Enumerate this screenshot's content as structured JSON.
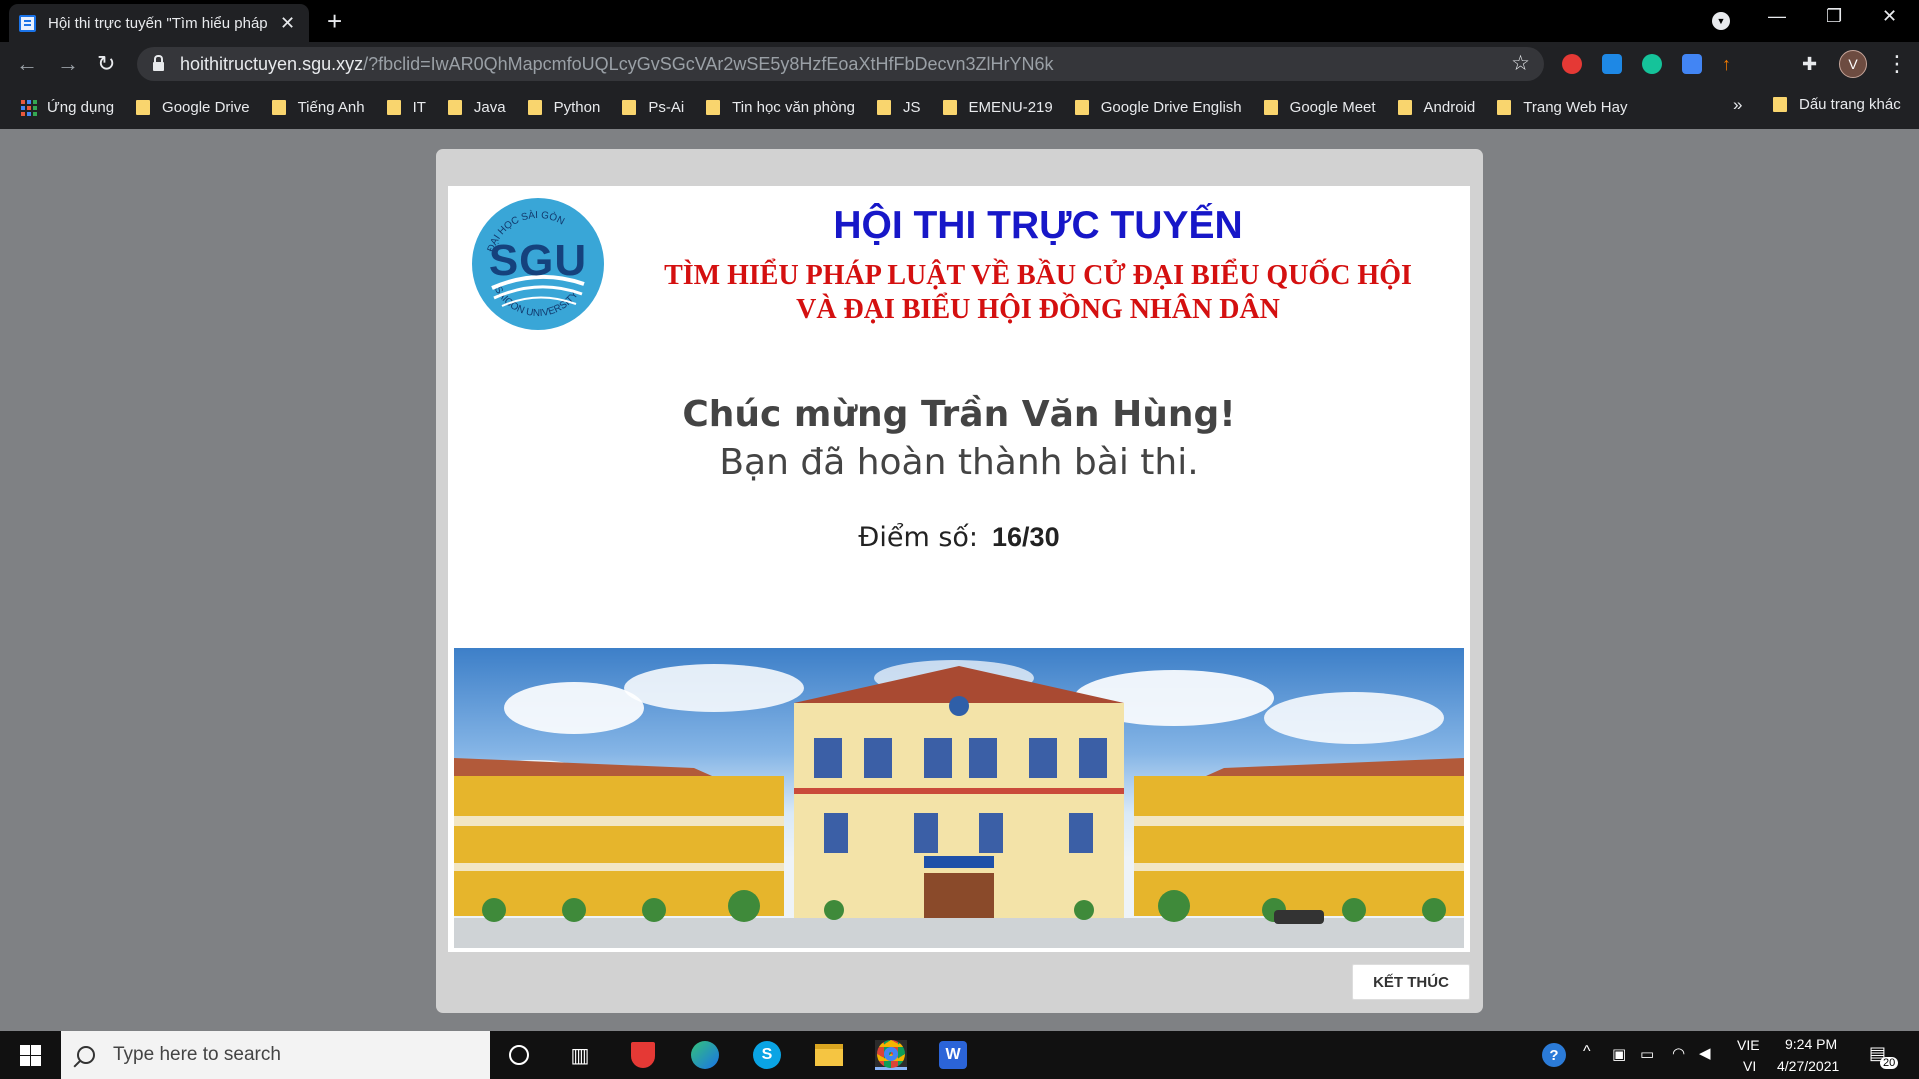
{
  "browser": {
    "tab_title": "Hội thi trực tuyến \"Tìm hiểu pháp",
    "tab_close": "✕",
    "new_tab": "+",
    "url_host": "hoithitructuyen.sgu.xyz",
    "url_path": "/?fbclid=IwAR0QhMapcmfoUQLcyGvSGcVAr2wSE5y8HzfEoaXtHfFbDecvn3ZlHrYN6k",
    "profile_initial": "V",
    "window_min": "—",
    "window_restore": "❐",
    "window_close": "✕"
  },
  "bookmarks": {
    "apps_label": "Ứng dụng",
    "items": [
      "Google Drive",
      "Tiếng Anh",
      "IT",
      "Java",
      "Python",
      "Ps-Ai",
      "Tin học văn phòng",
      "JS",
      "EMENU-219",
      "Google Drive English",
      "Google Meet",
      "Android",
      "Trang Web Hay"
    ],
    "more": "»",
    "other": "Dấu trang khác"
  },
  "page": {
    "logo_text": "SGU",
    "logo_top": "ĐẠI HỌC SÀI GÒN",
    "logo_bottom": "SAIGON UNIVERSITY",
    "title": "HỘI THI TRỰC TUYẾN",
    "subtitle_1": "TÌM HIỂU PHÁP LUẬT VỀ BẦU CỬ ĐẠI BIỂU QUỐC HỘI",
    "subtitle_2": "VÀ ĐẠI BIỂU HỘI ĐỒNG NHÂN DÂN",
    "congrats": "Chúc mừng Trần Văn Hùng!",
    "done": "Bạn đã hoàn thành bài thi.",
    "score_label": "Điểm số:",
    "score_value": "16/30",
    "finish_button": "KẾT THÚC"
  },
  "taskbar": {
    "search_placeholder": "Type here to search",
    "lang_1": "VIE",
    "lang_2": "VI",
    "time": "9:24 PM",
    "date": "4/27/2021",
    "notif_count": "20"
  },
  "colors": {
    "title_blue": "#1717c8",
    "subtitle_red": "#d41010",
    "logo_blue": "#39a6d7"
  }
}
